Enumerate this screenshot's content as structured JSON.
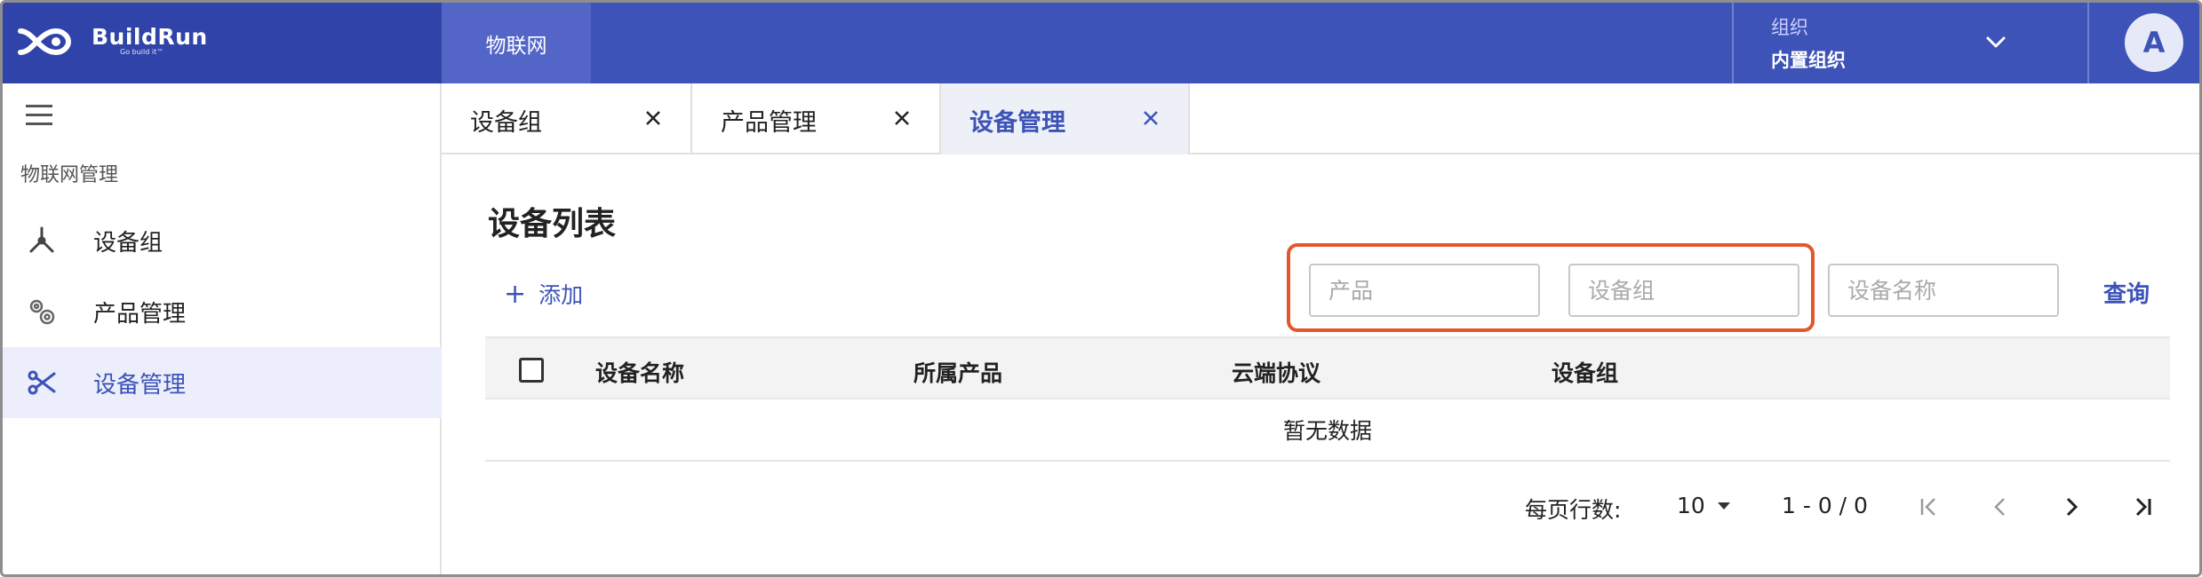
{
  "header": {
    "brand_name": "BuildRun",
    "brand_tagline": "Go build it™",
    "module": "物联网",
    "org_label": "组织",
    "org_name": "内置组织",
    "avatar_letter": "A",
    "colors": {
      "primary": "#3d53b8",
      "brand_bg": "#2f43a8",
      "module_bg": "#5366c8",
      "highlight": "#e4572e"
    }
  },
  "sidebar": {
    "section_title": "物联网管理",
    "items": [
      {
        "label": "设备组",
        "icon": "tools-icon",
        "active": false
      },
      {
        "label": "产品管理",
        "icon": "gears-icon",
        "active": false
      },
      {
        "label": "设备管理",
        "icon": "scissors-icon",
        "active": true
      }
    ]
  },
  "tabs": [
    {
      "label": "设备组",
      "active": false
    },
    {
      "label": "产品管理",
      "active": false
    },
    {
      "label": "设备管理",
      "active": true
    }
  ],
  "main": {
    "title": "设备列表",
    "add_label": "添加",
    "filters": {
      "product_placeholder": "产品",
      "group_placeholder": "设备组",
      "name_placeholder": "设备名称"
    },
    "query_label": "查询",
    "table": {
      "columns": [
        "设备名称",
        "所属产品",
        "云端协议",
        "设备组"
      ],
      "empty_text": "暂无数据"
    },
    "pagination": {
      "rows_per_page_label": "每页行数:",
      "rows_per_page": "10",
      "range": "1 - 0 / 0"
    }
  }
}
